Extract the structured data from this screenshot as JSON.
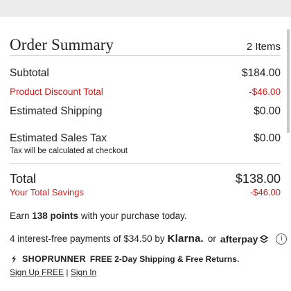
{
  "summary": {
    "title": "Order Summary",
    "items_count": "2 Items",
    "lines": [
      {
        "label": "Subtotal",
        "value": "$184.00"
      },
      {
        "label": "Product Discount Total",
        "value": "-$46.00"
      },
      {
        "label": "Estimated Shipping",
        "value": "$0.00"
      },
      {
        "label": "Estimated Sales Tax",
        "value": "$0.00"
      }
    ],
    "tax_note": "Tax will be calculated at checkout",
    "total": {
      "label": "Total",
      "value": "$138.00"
    },
    "savings": {
      "label": "Your Total Savings",
      "value": "-$46.00"
    }
  },
  "rewards": {
    "prefix": "Earn ",
    "points": "138 points",
    "suffix": " with your purchase today."
  },
  "financing": {
    "text": "4 interest-free payments of $34.50 by",
    "klarna": "Klarna.",
    "or": "or",
    "afterpay": "afterpay",
    "info": "i"
  },
  "shoprunner": {
    "brand": "SHOPRUNNER",
    "offer": "FREE 2-Day Shipping & Free Returns.",
    "signup": "Sign Up FREE",
    "separator": "|",
    "signin": "Sign In"
  },
  "colors": {
    "discount_red": "#cc1a1a",
    "text": "#222222",
    "divider": "#c9c9c9",
    "topbar": "#ececec"
  }
}
